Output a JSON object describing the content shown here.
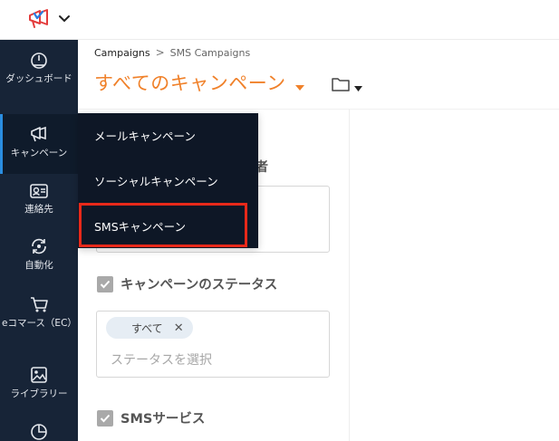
{
  "header": {
    "logo_icon": "megaphone-logo-icon",
    "switch_icon": "chevron-down-icon"
  },
  "sidebar": {
    "items": [
      {
        "label": "ダッシュボード",
        "icon": "gauge-icon"
      },
      {
        "label": "キャンペーン",
        "icon": "megaphone-icon"
      },
      {
        "label": "連絡先",
        "icon": "contact-card-icon"
      },
      {
        "label": "自動化",
        "icon": "automation-icon"
      },
      {
        "label": "eコマース（EC）",
        "icon": "cart-icon"
      },
      {
        "label": "ライブラリー",
        "icon": "image-icon"
      },
      {
        "label": "",
        "icon": "pie-chart-icon"
      }
    ],
    "active_index": 1
  },
  "breadcrumb": {
    "link": "Campaigns",
    "separator": ">",
    "current": "SMS Campaigns"
  },
  "page": {
    "title": "すべてのキャンペーン",
    "title_color": "#f0812a"
  },
  "filters": {
    "partial_heading": "者",
    "status": {
      "label": "キャンペーンのステータス",
      "chip": "すべて",
      "chip_close": "✕",
      "placeholder": "ステータスを選択",
      "checked": true
    },
    "sms_service": {
      "label": "SMSサービス",
      "checked": true
    }
  },
  "flyout": {
    "items": [
      "メールキャンペーン",
      "ソーシャルキャンペーン",
      "SMSキャンペーン"
    ],
    "highlighted_index": 2,
    "highlight_color": "#e8291a"
  }
}
